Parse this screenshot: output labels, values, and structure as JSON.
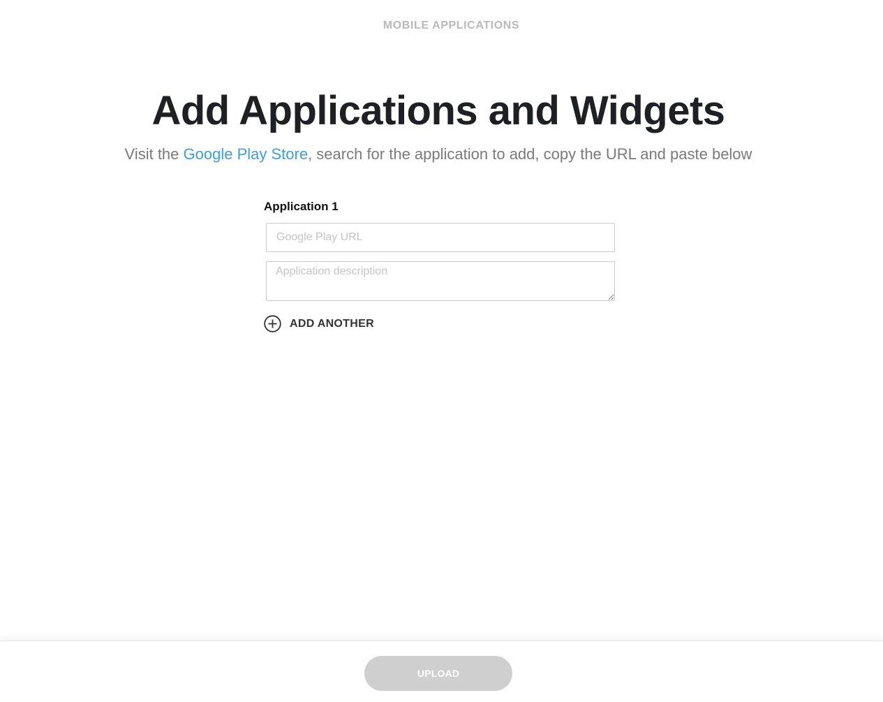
{
  "header": {
    "section_label": "MOBILE APPLICATIONS",
    "title": "Add Applications and Widgets",
    "subtitle_prefix": "Visit the ",
    "subtitle_link": "Google Play Store",
    "subtitle_suffix": ", search for the application to add, copy the URL and paste below"
  },
  "form": {
    "applications": [
      {
        "label": "Application 1",
        "url_placeholder": "Google Play URL",
        "url_value": "",
        "description_placeholder": "Application description",
        "description_value": ""
      }
    ],
    "add_another_label": "ADD ANOTHER",
    "add_another_icon": "plus-circle-icon"
  },
  "footer": {
    "upload_label": "UPLOAD",
    "upload_state": "disabled"
  },
  "colors": {
    "link": "#3a9fe0",
    "title": "#1f2023",
    "muted": "#7a7a7a",
    "button_disabled": "#cfcfcf"
  }
}
